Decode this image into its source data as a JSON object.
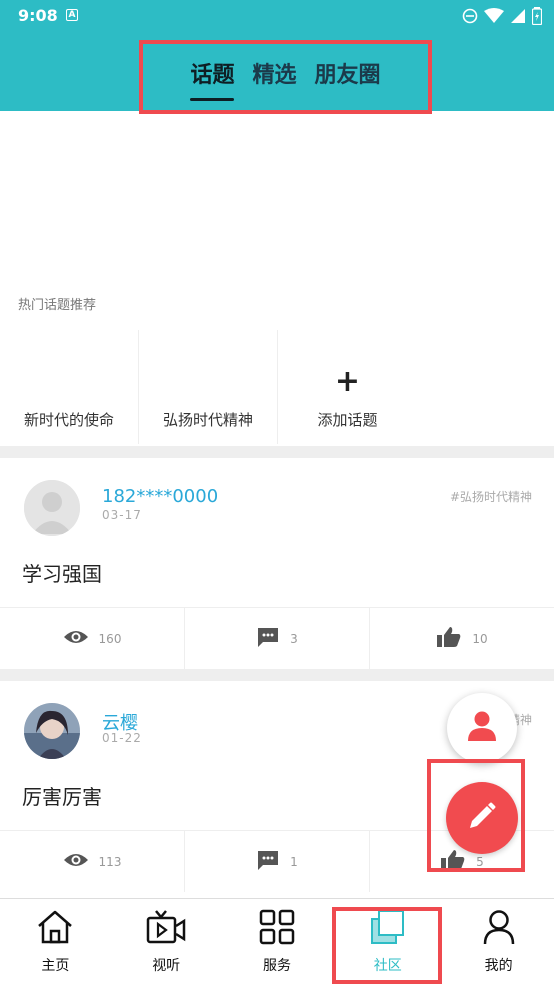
{
  "status_bar": {
    "time": "9:08",
    "icon_label": "A"
  },
  "top_tabs": [
    {
      "label": "话题",
      "active": true
    },
    {
      "label": "精选",
      "active": false
    },
    {
      "label": "朋友圈",
      "active": false
    }
  ],
  "hot_topics": {
    "title": "热门话题推荐",
    "items": [
      {
        "label": "新时代的使命"
      },
      {
        "label": "弘扬时代精神"
      },
      {
        "label": "添加话题",
        "icon": "plus-icon"
      }
    ]
  },
  "posts": [
    {
      "name": "182****0000",
      "date": "03-17",
      "tag": "#弘扬时代精神",
      "content": "学习强国",
      "views": "160",
      "comments": "3",
      "likes": "10"
    },
    {
      "name": "云樱",
      "date": "01-22",
      "tag": "#弘扬时代精神",
      "content": "厉害厉害",
      "views": "113",
      "comments": "1",
      "likes": "5"
    }
  ],
  "bottom_nav": [
    {
      "label": "主页",
      "icon": "home-icon"
    },
    {
      "label": "视听",
      "icon": "video-icon"
    },
    {
      "label": "服务",
      "icon": "grid-icon"
    },
    {
      "label": "社区",
      "icon": "community-icon",
      "active": true
    },
    {
      "label": "我的",
      "icon": "profile-icon"
    }
  ],
  "colors": {
    "accent": "#2dbcc5",
    "highlight": "#ef4a4f",
    "link": "#2aa8d8"
  }
}
